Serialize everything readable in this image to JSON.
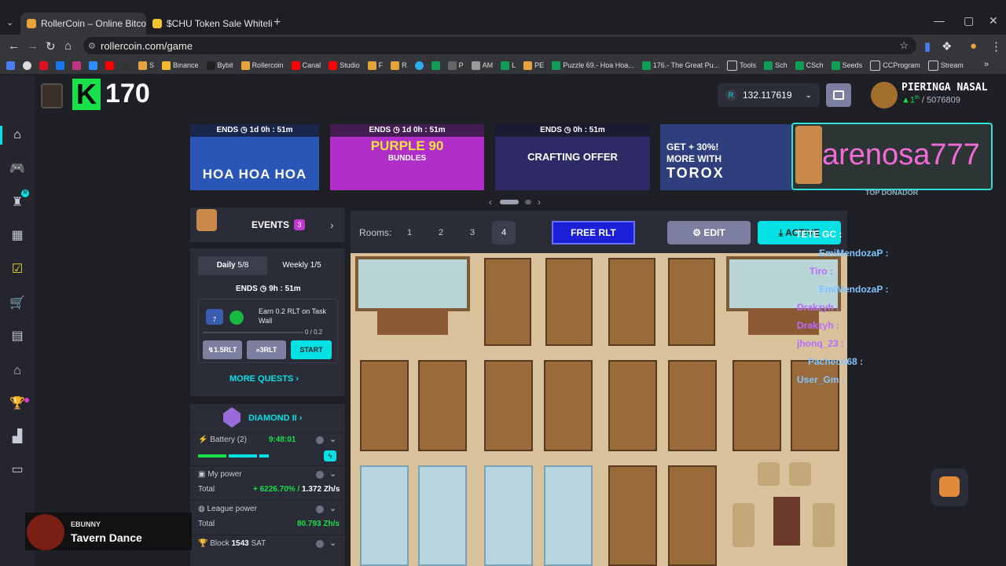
{
  "browser": {
    "tabs": [
      "RollerCoin – Online Bitcoin Mining",
      "$CHU Token Sale Whitelist | Ch"
    ],
    "url": "rollercoin.com/game",
    "bookmarks": [
      "Binance",
      "Bybit",
      "Rollercoin",
      "Canal",
      "Studio",
      "F",
      "R",
      "P",
      "AM",
      "L",
      "PE",
      "Puzzle 69.- Hoa Hoa...",
      "176.- The Great Pu...",
      "Tools",
      "Sch",
      "CSch",
      "Seeds",
      "CCProgram",
      "Stream"
    ],
    "bookmark_single": [
      "S"
    ]
  },
  "header": {
    "level": "170",
    "level_letter": "K",
    "balance": "132.117619",
    "balance_currency": "R",
    "username": "PIERINGA NASAL",
    "rank": "1",
    "rank_suffix": "th",
    "rank_total": "/ 5076809"
  },
  "banners": [
    {
      "ends": "ENDS",
      "time": "1d 0h : 51m",
      "text": "HOA HOA HOA",
      "color": "#2a56b8"
    },
    {
      "ends": "ENDS",
      "time": "1d 0h : 51m",
      "text": "PURPLE 90",
      "sub": "BUNDLES",
      "color": "#b12fc8"
    },
    {
      "ends": "ENDS",
      "time": "0h : 51m",
      "text": "CRAFTING OFFER",
      "color": "#2d2a66"
    },
    {
      "line1": "GET + 30%!",
      "line2": "MORE WITH",
      "line3": "TOROX",
      "color": "#2f3f7e"
    }
  ],
  "overlay": {
    "name": "arenosa777",
    "label": "TOP DONADOR"
  },
  "events": {
    "title": "EVENTS",
    "count": "3",
    "tab_daily": "Daily",
    "daily_progress": "5/8",
    "tab_weekly": "Weekly",
    "weekly_progress": "1/5",
    "ends_label": "ENDS",
    "ends_time": "9h : 51m",
    "quest_text": "Earn 0.2 RLT on Task Wall",
    "quest_progress": "0 / 0.2",
    "quest_xp": "7",
    "btn_a": "1.5RLT",
    "btn_b": "3RLT",
    "btn_start": "START",
    "more_quests": "MORE QUESTS"
  },
  "league": {
    "name": "DIAMOND II",
    "battery_label": "Battery (2)",
    "battery_time": "9:48:01",
    "my_power_label": "My power",
    "total_label": "Total",
    "my_power_bonus": "+ 6226.70%",
    "my_power_value": "1.372 Zh/s",
    "league_power_label": "League power",
    "league_total": "80.793 Zh/s",
    "block_label": "Block",
    "block_number": "1543",
    "block_currency": "SAT"
  },
  "room": {
    "label": "Rooms:",
    "rooms": [
      "1",
      "2",
      "3",
      "4"
    ],
    "active_room": "4",
    "free_rlt": "FREE RLT",
    "edit": "EDIT",
    "action": "ACTIVE"
  },
  "chat": [
    {
      "name": "TETE GC :",
      "color": "#ffffff"
    },
    {
      "name": "EmiMendozaP :",
      "color": "#4aa9ff"
    },
    {
      "name": "Tiro :",
      "color": "#b86bff"
    },
    {
      "name": "EmiMendozaP :",
      "color": "#4aa9ff"
    },
    {
      "name": "Drakzyh :",
      "color": "#b86bff"
    },
    {
      "name": "Drakzyh :",
      "color": "#b86bff"
    },
    {
      "name": "jhonq_23 :",
      "color": "#b86bff"
    },
    {
      "name": "Pacheco68 :",
      "color": "#4aa9ff"
    },
    {
      "name": "User_Gm :",
      "color": "#4aa9ff"
    }
  ],
  "music": {
    "artist": "EBUNNY",
    "title": "Tavern Dance"
  },
  "colors": {
    "accent": "#03e1e4",
    "green": "#18e04a",
    "free_rlt": "#1b1fd8",
    "room_floor": "#d9c29b"
  }
}
